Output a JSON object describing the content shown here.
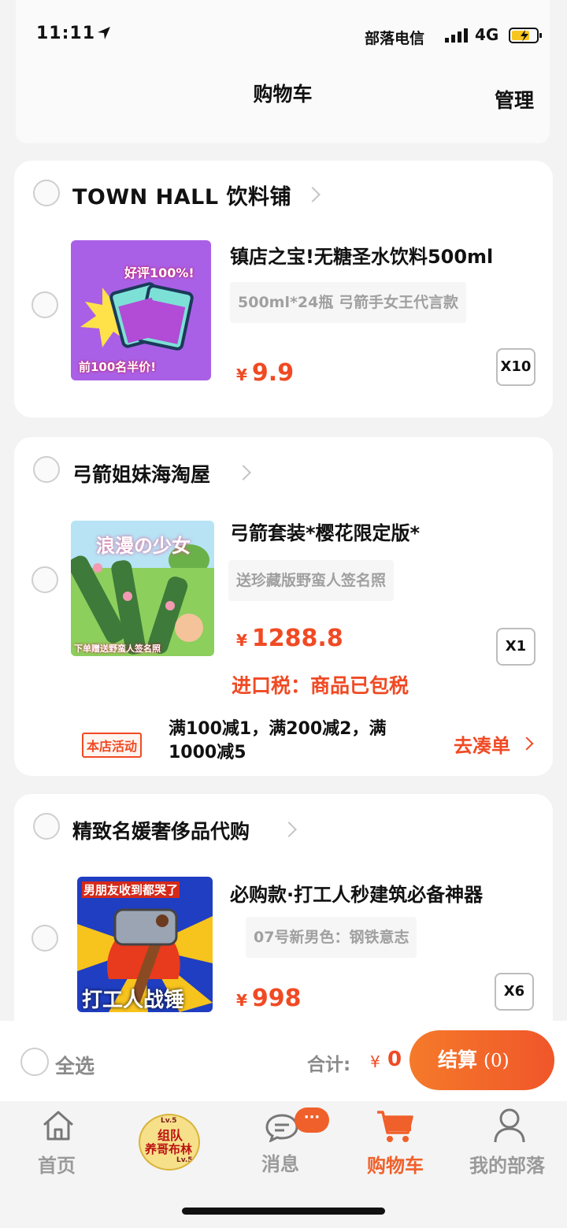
{
  "status_bar": {
    "time": "11:11",
    "carrier": "部落电信",
    "network": "4G"
  },
  "header": {
    "title": "购物车",
    "manage_label": "管理"
  },
  "shops": [
    {
      "name": "TOWN HALL 饮料铺",
      "item": {
        "title": "镇店之宝!无糖圣水饮料500ml",
        "spec": "500ml*24瓶 弓箭手女王代言款",
        "currency": "¥",
        "price": "9.9",
        "qty": "X10",
        "image_text": {
          "top": "好评100%!",
          "bottom": "前100名半价!"
        }
      }
    },
    {
      "name": "弓箭姐妹海淘屋",
      "item": {
        "title": "弓箭套装*樱花限定版*",
        "spec": "送珍藏版野蛮人签名照",
        "currency": "¥",
        "price": "1288.8",
        "qty": "X1",
        "tax_note": "进口税：商品已包税",
        "image_text": {
          "top": "浪漫の少女",
          "bottom": "下单赠送野蛮人签名照"
        }
      },
      "promo": {
        "tag": "本店活动",
        "text": "满100减1，满200减2，满1000减5",
        "action": "去凑单"
      }
    },
    {
      "name": "精致名媛奢侈品代购",
      "item": {
        "title": "必购款·打工人秒建筑必备神器",
        "spec": "07号新男色：钢铁意志",
        "currency": "¥",
        "price": "998",
        "qty": "X6",
        "image_text": {
          "top": "男朋友收到都哭了",
          "bottom": "打工人战锤"
        }
      }
    }
  ],
  "checkout_bar": {
    "select_all": "全选",
    "total_label": "合计:",
    "currency": "¥",
    "total_value": "0",
    "checkout_label": "结算",
    "checkout_count": "(0)"
  },
  "tabbar": {
    "items": [
      {
        "label": "首页",
        "icon": "home-icon"
      },
      {
        "label": "",
        "icon": "clan-avatar-icon",
        "avatar_text": {
          "line1": "组队",
          "line2": "养哥布林",
          "lv_top": "Lv.5",
          "lv_bottom": "Lv.51"
        }
      },
      {
        "label": "消息",
        "icon": "chat-icon",
        "badge": "···"
      },
      {
        "label": "购物车",
        "icon": "cart-icon",
        "active": true
      },
      {
        "label": "我的部落",
        "icon": "user-icon"
      }
    ]
  },
  "colors": {
    "accent": "#f0602a",
    "price": "#f04a24",
    "background": "#f3f3f3"
  }
}
